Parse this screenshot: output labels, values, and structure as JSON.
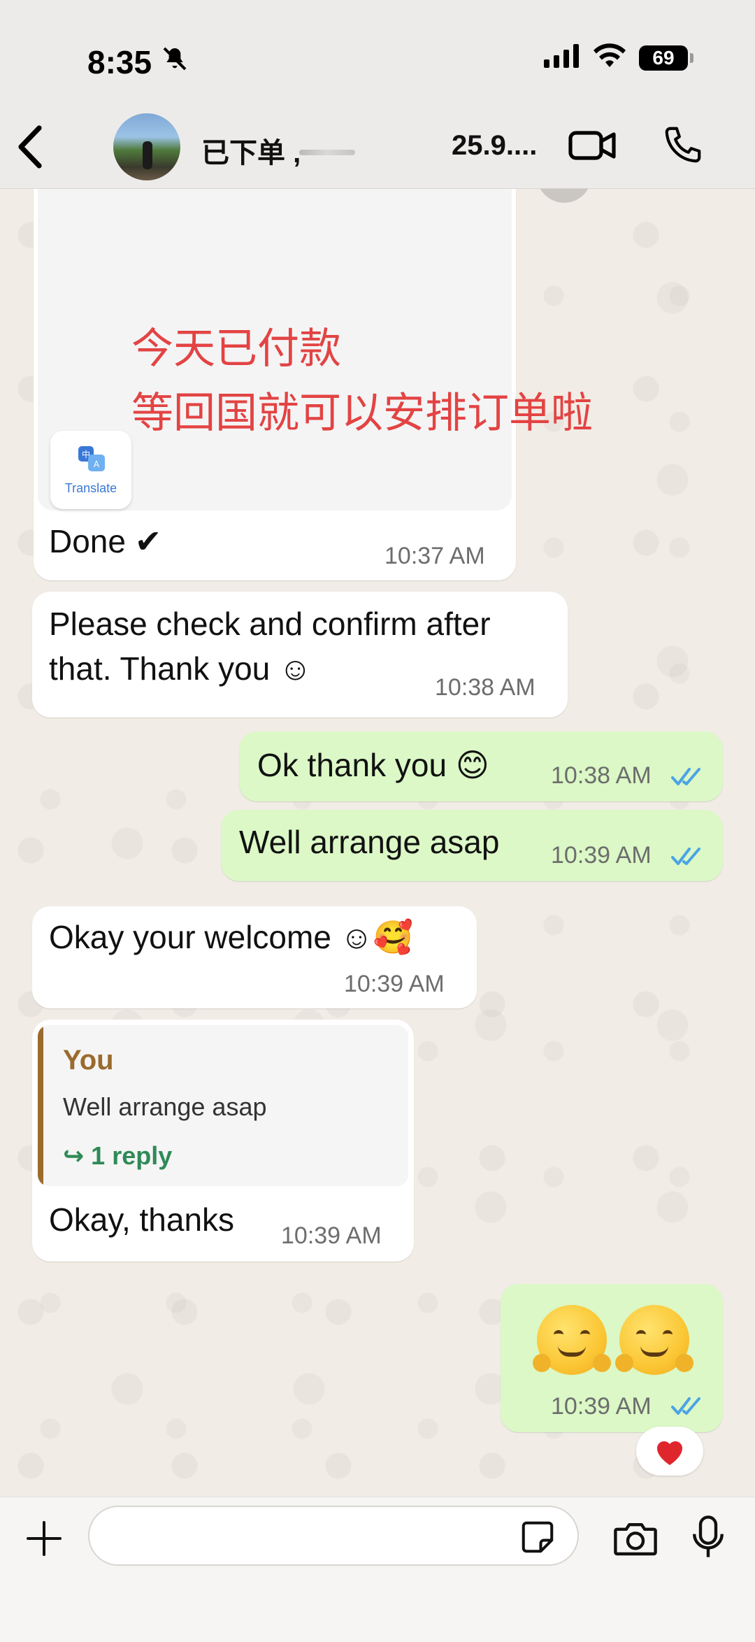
{
  "status_bar": {
    "time": "8:35",
    "battery": "69"
  },
  "header": {
    "contact_name": "已下单 ,",
    "contact_number": "25.9...."
  },
  "image_message": {
    "line1": "今天已付款",
    "line2": "等回国就可以安排订单啦",
    "translate_label": "Translate"
  },
  "messages": [
    {
      "direction": "in",
      "text": "Done ✔",
      "time": "10:37 AM"
    },
    {
      "direction": "in",
      "text": "Please check and confirm after\nthat. Thank you ☺",
      "time": "10:38 AM"
    },
    {
      "direction": "out",
      "text": "Ok thank you 😊",
      "time": "10:38 AM"
    },
    {
      "direction": "out",
      "text": "Well arrange asap",
      "time": "10:39 AM"
    },
    {
      "direction": "in",
      "text": "Okay your welcome ☺🥰",
      "time": "10:39 AM"
    },
    {
      "direction": "in",
      "text": "Okay, thanks",
      "time": "10:39 AM",
      "quote": {
        "author": "You",
        "text": "Well arrange asap",
        "replies": "↪ 1 reply"
      }
    },
    {
      "direction": "out",
      "text": "🤗 🤗",
      "time": "10:39 AM",
      "reaction": "❤"
    }
  ],
  "composer": {
    "placeholder": ""
  },
  "colors": {
    "incoming_bubble": "#ffffff",
    "outgoing_bubble": "#dbf8c6",
    "read_ticks": "#4aa3e6",
    "quote_accent": "#9a6b2d",
    "reply_link": "#2f8a57",
    "image_text": "#e34343"
  },
  "icons": [
    "back-arrow-icon",
    "video-call-icon",
    "phone-icon",
    "plus-icon",
    "sticker-icon",
    "camera-icon",
    "microphone-icon",
    "translate-icon",
    "double-check-icon",
    "bell-slash-icon",
    "signal-icon",
    "wifi-icon"
  ]
}
